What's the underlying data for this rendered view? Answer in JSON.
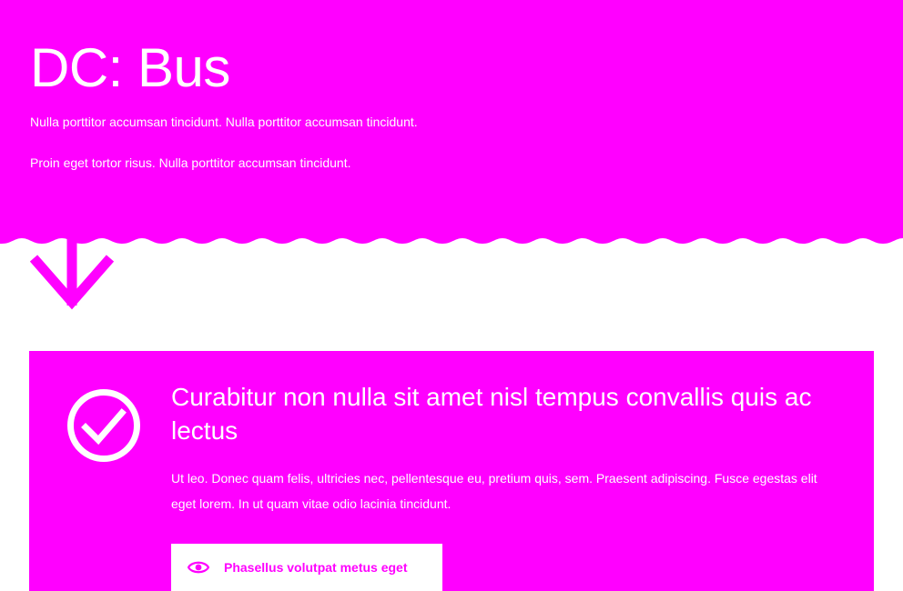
{
  "hero": {
    "title": "DC: Bus",
    "paragraphs": [
      "Nulla porttitor accumsan tincidunt. Nulla porttitor accumsan tincidunt.",
      "Proin eget tortor risus. Nulla porttitor accumsan tincidunt."
    ]
  },
  "card": {
    "heading": "Curabitur non nulla sit amet nisl tempus convallis quis ac lectus",
    "body": "Ut leo. Donec quam felis, ultricies nec, pellentesque eu, pretium quis, sem. Praesent adipiscing. Fusce egestas elit eget lorem. In ut quam vitae odio lacinia tincidunt.",
    "button_label": "Phasellus volutpat metus eget"
  },
  "colors": {
    "brand": "#ff00ff",
    "background": "#ffffff",
    "text_on_brand": "#ffffff"
  },
  "icons": {
    "scroll": "arrow-down-icon",
    "status": "check-circle-icon",
    "button": "eye-icon"
  }
}
